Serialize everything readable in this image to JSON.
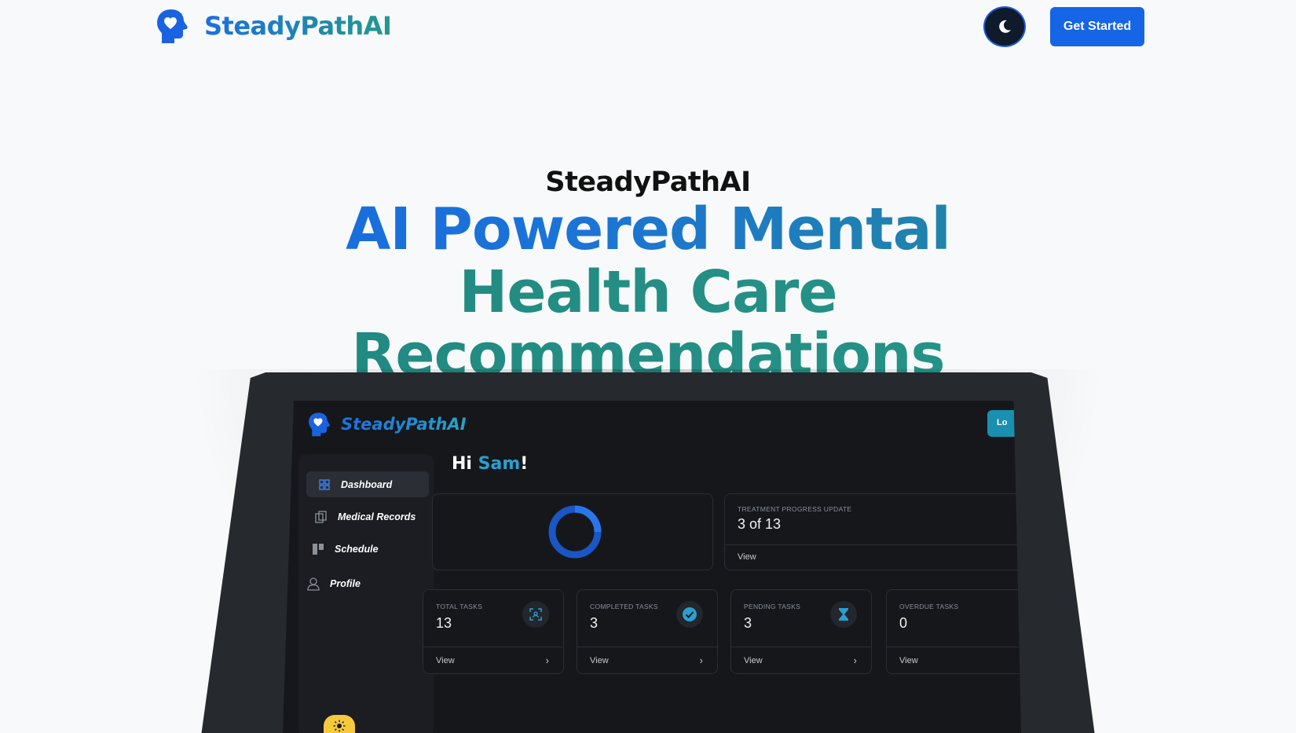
{
  "navbar": {
    "brand_name": "SteadyPathAI",
    "get_started_label": "Get Started"
  },
  "hero": {
    "subtitle": "SteadyPathAI",
    "title_line1_part1": "AI Powered Mental",
    "title_line2": "Health Care",
    "title_line3": "Recommendations"
  },
  "app": {
    "brand_name": "SteadyPathAI",
    "logout_tab_label": "Lo",
    "sidebar": {
      "items": [
        {
          "label": "Dashboard",
          "icon": "dashboard-icon"
        },
        {
          "label": "Medical Records",
          "icon": "records-icon"
        },
        {
          "label": "Schedule",
          "icon": "schedule-icon"
        },
        {
          "label": "Profile",
          "icon": "profile-icon"
        }
      ]
    },
    "greeting": {
      "prefix": "Hi ",
      "name": "Sam",
      "suffix": "!"
    },
    "treatment_card": {
      "label": "TREATMENT PROGRESS UPDATE",
      "value": "3 of 13",
      "view_label": "View"
    },
    "stats": [
      {
        "label": "TOTAL TASKS",
        "value": "13",
        "view_label": "View",
        "icon": "scan-icon"
      },
      {
        "label": "COMPLETED TASKS",
        "value": "3",
        "view_label": "View",
        "icon": "check-circle-icon"
      },
      {
        "label": "PENDING TASKS",
        "value": "3",
        "view_label": "View",
        "icon": "hourglass-icon"
      },
      {
        "label": "OVERDUE TASKS",
        "value": "0",
        "view_label": "View",
        "icon": "alert-icon"
      }
    ]
  },
  "colors": {
    "primary_blue": "#1565e6",
    "teal": "#26978a",
    "accent_cyan": "#2a9fd0",
    "app_background": "#15171b",
    "sun_button": "#f6c93d"
  }
}
